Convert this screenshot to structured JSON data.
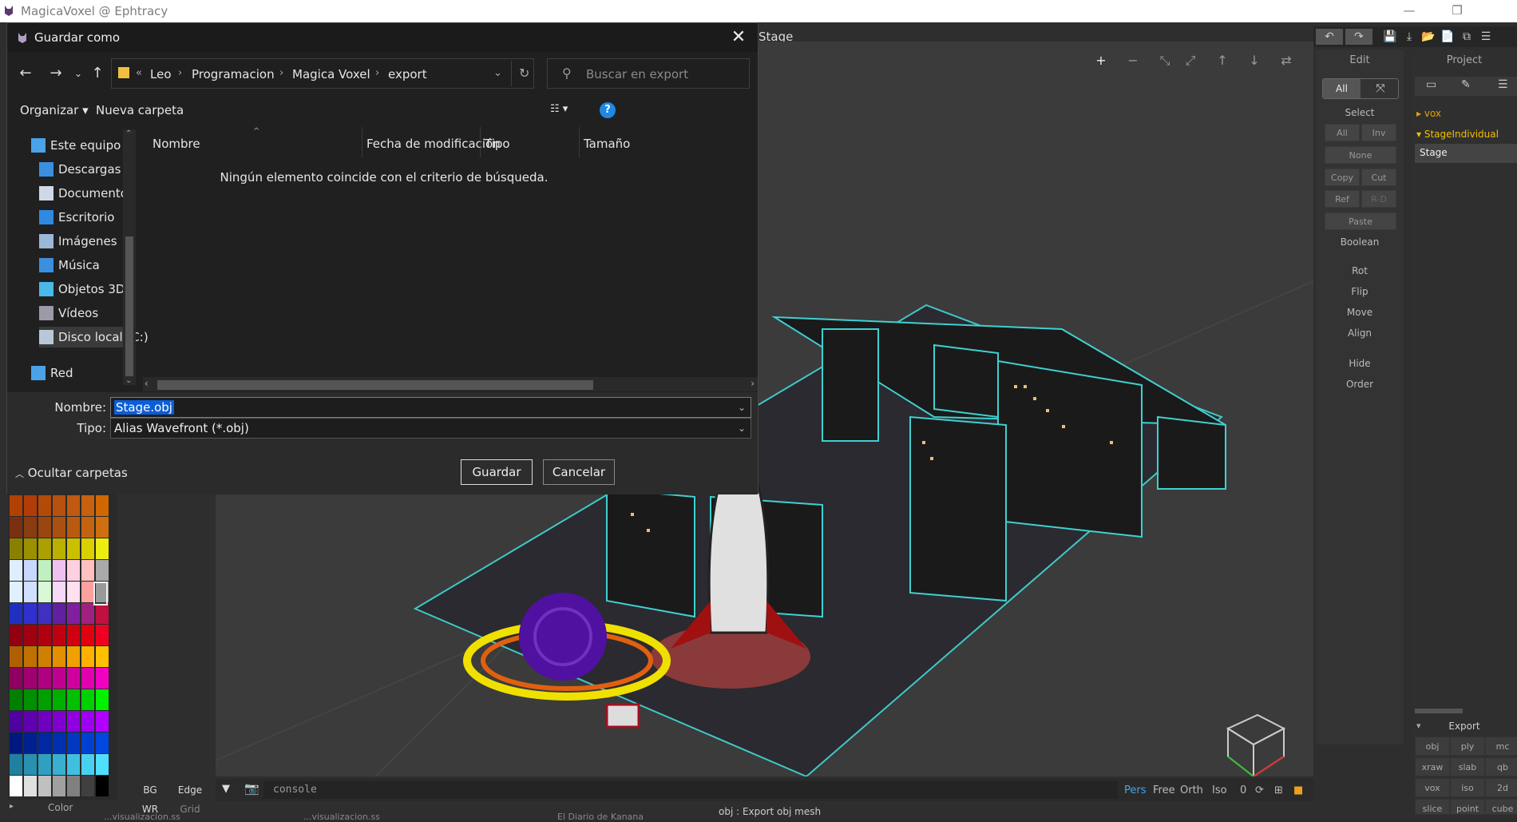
{
  "window": {
    "title": "MagicaVoxel @ Ephtracy",
    "minimize": "—",
    "restore": "❐"
  },
  "app": {
    "tab_title": "Stage",
    "top_tools": [
      "↶",
      "↷",
      "💾",
      "⤓",
      "📂",
      "📄",
      "⧉",
      "☰"
    ],
    "viewport_tools": [
      "+",
      "−",
      "⤡",
      "⤢",
      "↑",
      "↓",
      "⇄"
    ],
    "edit_panel": {
      "title": "Edit",
      "all_label": "All",
      "select_label": "Select",
      "buttons": {
        "all": "All",
        "inv": "Inv",
        "none": "None",
        "copy": "Copy",
        "cut": "Cut",
        "ref": "Ref",
        "rd": "R-D",
        "paste": "Paste"
      },
      "labels": {
        "boolean": "Boolean",
        "rot": "Rot",
        "flip": "Flip",
        "move": "Move",
        "align": "Align",
        "hide": "Hide",
        "order": "Order"
      }
    },
    "project_panel": {
      "title": "Project",
      "items": [
        "vox",
        "StageIndividual",
        "Stage"
      ],
      "export_title": "Export",
      "export_buttons": [
        [
          "obj",
          "ply",
          "mc"
        ],
        [
          "xraw",
          "slab",
          "qb"
        ],
        [
          "vox",
          "iso",
          "2d"
        ],
        [
          "slice",
          "point",
          "cube"
        ]
      ]
    },
    "palette": {
      "colors": [
        [
          "#b24000",
          "#b23c08",
          "#b24a08",
          "#b85010",
          "#c05a10",
          "#c86010",
          "#d06800"
        ],
        [
          "#7a3010",
          "#8a3c10",
          "#9a4610",
          "#aa5010",
          "#b85a10",
          "#c46410",
          "#d06e10"
        ],
        [
          "#8a8000",
          "#9a9000",
          "#aaa000",
          "#bab000",
          "#cac000",
          "#dad000",
          "#ecec10"
        ],
        [
          "#dfeeff",
          "#c8d8ff",
          "#c0f0c0",
          "#f0c0f0",
          "#ffd0e0",
          "#ffc0c0",
          "#aaaaaa"
        ],
        [
          "#e0f0ff",
          "#d0e0ff",
          "#d8f8d8",
          "#f8d8f8",
          "#ffe0f0",
          "#ffa0a0",
          "#999999"
        ],
        [
          "#2030c0",
          "#3030d0",
          "#4030c0",
          "#6020a0",
          "#8020a0",
          "#a02080",
          "#c01040"
        ],
        [
          "#900010",
          "#a00010",
          "#b00010",
          "#c00010",
          "#d00010",
          "#e00010",
          "#f00020"
        ],
        [
          "#b06000",
          "#c07000",
          "#d08000",
          "#e09000",
          "#f0a000",
          "#ffb000",
          "#ffc000"
        ],
        [
          "#900060",
          "#a00070",
          "#b00080",
          "#c00090",
          "#d000a0",
          "#e000b0",
          "#f000c0"
        ],
        [
          "#008000",
          "#009000",
          "#00a000",
          "#00b000",
          "#00c000",
          "#00d000",
          "#00f000"
        ],
        [
          "#5000a0",
          "#6000b0",
          "#7000c0",
          "#8000d0",
          "#9000e0",
          "#a000f0",
          "#b000ff"
        ],
        [
          "#001880",
          "#002090",
          "#0028a0",
          "#0030b0",
          "#0038c0",
          "#0040d0",
          "#0048e0"
        ],
        [
          "#2080a0",
          "#2890b0",
          "#30a0c0",
          "#38b0d0",
          "#40c0e0",
          "#48d0f0",
          "#50e0ff"
        ],
        [
          "#ffffff",
          "#e0e0e0",
          "#c0c0c0",
          "#a0a0a0",
          "#808080",
          "#404040",
          "#000000"
        ]
      ],
      "color_label": "Color"
    },
    "bottom": {
      "console_placeholder": "console",
      "cam_modes": [
        "Pers",
        "Free",
        "Orth",
        "Iso"
      ],
      "zero": "0",
      "bg": "BG",
      "edge": "Edge",
      "wr": "WR",
      "grid": "Grid",
      "status": "obj : Export obj mesh",
      "taskbar_left": "...visualizacion.ss",
      "taskbar_mid": "...visualizacion.ss",
      "taskbar_right": "El Diario de Kanana"
    }
  },
  "dialog": {
    "title": "Guardar como",
    "breadcrumb": [
      "Leo",
      "Programacion",
      "Magica Voxel",
      "export"
    ],
    "breadcrumb_prefix": "«",
    "search_placeholder": "Buscar en export",
    "cmd": {
      "organize": "Organizar ▾",
      "new_folder": "Nueva carpeta"
    },
    "nav_items": [
      {
        "label": "Este equipo",
        "icon": "computer-icon",
        "color": "#4aa3e8"
      },
      {
        "label": "Descargas",
        "icon": "download-icon",
        "color": "#3b8fe0"
      },
      {
        "label": "Documentos",
        "icon": "document-icon",
        "color": "#cfd8e6"
      },
      {
        "label": "Escritorio",
        "icon": "desktop-icon",
        "color": "#2d8ae0"
      },
      {
        "label": "Imágenes",
        "icon": "images-icon",
        "color": "#9ab8d8"
      },
      {
        "label": "Música",
        "icon": "music-icon",
        "color": "#3b8fe0"
      },
      {
        "label": "Objetos 3D",
        "icon": "cube-icon",
        "color": "#4ab8e8"
      },
      {
        "label": "Vídeos",
        "icon": "video-icon",
        "color": "#9a9aa8"
      },
      {
        "label": "Disco local (C:)",
        "icon": "drive-icon",
        "color": "#b8c8d8"
      },
      {
        "label": "Red",
        "icon": "network-icon",
        "color": "#4aa3e8"
      }
    ],
    "columns": [
      "Nombre",
      "Fecha de modificación",
      "Tipo",
      "Tamaño"
    ],
    "empty_message": "Ningún elemento coincide con el criterio de búsqueda.",
    "name_label": "Nombre:",
    "name_value": "Stage.obj",
    "type_label": "Tipo:",
    "type_value": "Alias Wavefront (*.obj)",
    "hide_folders": "Ocultar carpetas",
    "save": "Guardar",
    "cancel": "Cancelar"
  }
}
